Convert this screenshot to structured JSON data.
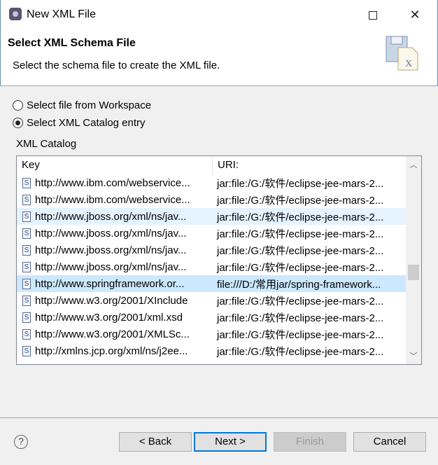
{
  "window": {
    "title": "New XML File",
    "maximize_icon": "maximize-icon",
    "close_icon": "close-icon"
  },
  "header": {
    "title": "Select XML Schema File",
    "description": "Select the schema file to create the XML file."
  },
  "options": [
    {
      "label": "Select file from Workspace",
      "selected": false
    },
    {
      "label": "Select XML Catalog entry",
      "selected": true
    }
  ],
  "catalog": {
    "label": "XML Catalog",
    "columns": [
      "Key",
      "URI:"
    ],
    "rows": [
      {
        "key": "http://www.ibm.com/webservice...",
        "uri": "jar:file:/G:/软件/eclipse-jee-mars-2..."
      },
      {
        "key": "http://www.ibm.com/webservice...",
        "uri": "jar:file:/G:/软件/eclipse-jee-mars-2..."
      },
      {
        "key": "http://www.jboss.org/xml/ns/jav...",
        "uri": "jar:file:/G:/软件/eclipse-jee-mars-2...",
        "state": "hover"
      },
      {
        "key": "http://www.jboss.org/xml/ns/jav...",
        "uri": "jar:file:/G:/软件/eclipse-jee-mars-2..."
      },
      {
        "key": "http://www.jboss.org/xml/ns/jav...",
        "uri": "jar:file:/G:/软件/eclipse-jee-mars-2..."
      },
      {
        "key": "http://www.jboss.org/xml/ns/jav...",
        "uri": "jar:file:/G:/软件/eclipse-jee-mars-2..."
      },
      {
        "key": "http://www.springframework.or...",
        "uri": "file:///D:/常用jar/spring-framework...",
        "state": "selected"
      },
      {
        "key": "http://www.w3.org/2001/XInclude",
        "uri": "jar:file:/G:/软件/eclipse-jee-mars-2..."
      },
      {
        "key": "http://www.w3.org/2001/xml.xsd",
        "uri": "jar:file:/G:/软件/eclipse-jee-mars-2..."
      },
      {
        "key": "http://www.w3.org/2001/XMLSc...",
        "uri": "jar:file:/G:/软件/eclipse-jee-mars-2..."
      },
      {
        "key": "http://xmlns.jcp.org/xml/ns/j2ee...",
        "uri": "jar:file:/G:/软件/eclipse-jee-mars-2..."
      }
    ],
    "row_icon": "schema-file-icon"
  },
  "buttons": {
    "back": "< Back",
    "next": "Next >",
    "finish": "Finish",
    "cancel": "Cancel",
    "help_icon": "help-icon"
  },
  "colors": {
    "selected_row": "#cce8ff",
    "hover_row": "#e5f3ff",
    "default_button_border": "#0078d7"
  }
}
